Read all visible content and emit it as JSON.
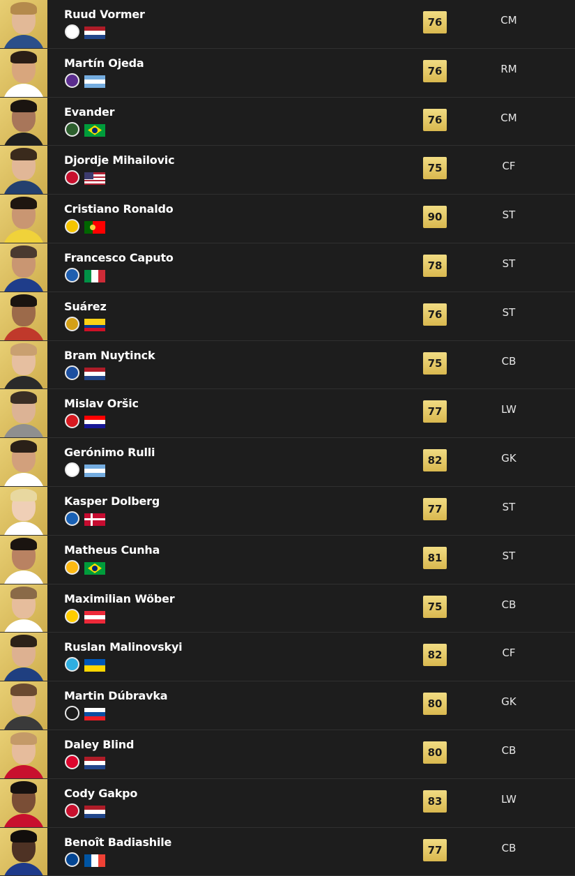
{
  "players": [
    {
      "name": "Ruud Vormer",
      "rating": "76",
      "position": "CM",
      "club_icon": "club-crest-icon",
      "nation": "netherlands-flag",
      "skin": "#e2b997",
      "hair": "#b48a4c",
      "kit": "#2b4f8a",
      "club_color": "#ffffff",
      "flag_colors": [
        "#ae1c28",
        "#ffffff",
        "#21468b"
      ],
      "flag_dir": "h"
    },
    {
      "name": "Martín Ojeda",
      "rating": "76",
      "position": "RM",
      "club_icon": "club-crest-icon",
      "nation": "argentina-flag",
      "skin": "#d8a67d",
      "hair": "#2a1e16",
      "kit": "#ffffff",
      "club_color": "#5b2d8e",
      "flag_colors": [
        "#74acdf",
        "#ffffff",
        "#74acdf"
      ],
      "flag_dir": "h"
    },
    {
      "name": "Evander",
      "rating": "76",
      "position": "CM",
      "club_icon": "club-crest-icon",
      "nation": "brazil-flag",
      "skin": "#a8765a",
      "hair": "#1a1410",
      "kit": "#1f1f1f",
      "club_color": "#2d5f2e",
      "flag_colors": [
        "#009c3b",
        "#ffdf00",
        "#002776"
      ],
      "flag_dir": "br"
    },
    {
      "name": "Djordje Mihailovic",
      "rating": "75",
      "position": "CF",
      "club_icon": "club-crest-icon",
      "nation": "usa-flag",
      "skin": "#e1b797",
      "hair": "#3a2a1c",
      "kit": "#24406e",
      "club_color": "#c8102e",
      "flag_colors": [
        "#b22234",
        "#ffffff",
        "#3c3b6e"
      ],
      "flag_dir": "us"
    },
    {
      "name": "Cristiano Ronaldo",
      "rating": "90",
      "position": "ST",
      "club_icon": "club-crest-icon",
      "nation": "portugal-flag",
      "skin": "#c99672",
      "hair": "#1e1610",
      "kit": "#f0d23a",
      "club_color": "#f5c400",
      "flag_colors": [
        "#006600",
        "#ff0000",
        "#ff0000"
      ],
      "flag_dir": "pt"
    },
    {
      "name": "Francesco Caputo",
      "rating": "78",
      "position": "ST",
      "club_icon": "club-crest-icon",
      "nation": "italy-flag",
      "skin": "#c99672",
      "hair": "#4a3a30",
      "kit": "#1f3d8a",
      "club_color": "#1f5fb0",
      "flag_colors": [
        "#009246",
        "#ffffff",
        "#ce2b37"
      ],
      "flag_dir": "v"
    },
    {
      "name": "Suárez",
      "rating": "76",
      "position": "ST",
      "club_icon": "club-crest-icon",
      "nation": "colombia-flag",
      "skin": "#9c6a4a",
      "hair": "#1a1410",
      "kit": "#c0392b",
      "club_color": "#d4a017",
      "flag_colors": [
        "#fcd116",
        "#003893",
        "#ce1126"
      ],
      "flag_dir": "co"
    },
    {
      "name": "Bram Nuytinck",
      "rating": "75",
      "position": "CB",
      "club_icon": "club-crest-icon",
      "nation": "netherlands-flag",
      "skin": "#e6bfa0",
      "hair": "#c9a070",
      "kit": "#2a2a2a",
      "club_color": "#1c4fa0",
      "flag_colors": [
        "#ae1c28",
        "#ffffff",
        "#21468b"
      ],
      "flag_dir": "h"
    },
    {
      "name": "Mislav Oršic",
      "rating": "77",
      "position": "LW",
      "club_icon": "club-crest-icon",
      "nation": "croatia-flag",
      "skin": "#dcb395",
      "hair": "#3a2e24",
      "kit": "#8f8f8f",
      "club_color": "#d71920",
      "flag_colors": [
        "#ff0000",
        "#ffffff",
        "#171796"
      ],
      "flag_dir": "h"
    },
    {
      "name": "Gerónimo Rulli",
      "rating": "82",
      "position": "GK",
      "club_icon": "club-crest-icon",
      "nation": "argentina-flag",
      "skin": "#d2a07c",
      "hair": "#2a2018",
      "kit": "#ffffff",
      "club_color": "#ffffff",
      "flag_colors": [
        "#74acdf",
        "#ffffff",
        "#74acdf"
      ],
      "flag_dir": "h"
    },
    {
      "name": "Kasper Dolberg",
      "rating": "77",
      "position": "ST",
      "club_icon": "club-crest-icon",
      "nation": "denmark-flag",
      "skin": "#efcfb6",
      "hair": "#e8d8a0",
      "kit": "#ffffff",
      "club_color": "#1961b5",
      "flag_colors": [
        "#c60c30",
        "#ffffff"
      ],
      "flag_dir": "dk"
    },
    {
      "name": "Matheus Cunha",
      "rating": "81",
      "position": "ST",
      "club_icon": "club-crest-icon",
      "nation": "brazil-flag",
      "skin": "#b98262",
      "hair": "#1a1410",
      "kit": "#ffffff",
      "club_color": "#fdb913",
      "flag_colors": [
        "#009c3b",
        "#ffdf00",
        "#002776"
      ],
      "flag_dir": "br"
    },
    {
      "name": "Maximilian Wöber",
      "rating": "75",
      "position": "CB",
      "club_icon": "club-crest-icon",
      "nation": "austria-flag",
      "skin": "#e6bd9c",
      "hair": "#8a6a48",
      "kit": "#ffffff",
      "club_color": "#ffcd00",
      "flag_colors": [
        "#ed2939",
        "#ffffff",
        "#ed2939"
      ],
      "flag_dir": "h"
    },
    {
      "name": "Ruslan Malinovskyi",
      "rating": "82",
      "position": "CF",
      "club_icon": "club-crest-icon",
      "nation": "ukraine-flag",
      "skin": "#ddb191",
      "hair": "#2c2218",
      "kit": "#1f3f80",
      "club_color": "#2faee0",
      "flag_colors": [
        "#0057b7",
        "#ffd700"
      ],
      "flag_dir": "h2"
    },
    {
      "name": "Martin Dúbravka",
      "rating": "80",
      "position": "GK",
      "club_icon": "club-crest-icon",
      "nation": "slovakia-flag",
      "skin": "#e2b796",
      "hair": "#6a4a30",
      "kit": "#3a3a3a",
      "club_color": "#1a1a1a",
      "flag_colors": [
        "#ffffff",
        "#0b4ea2",
        "#ee1c25"
      ],
      "flag_dir": "h"
    },
    {
      "name": "Daley Blind",
      "rating": "80",
      "position": "CB",
      "club_icon": "club-crest-icon",
      "nation": "netherlands-flag",
      "skin": "#e6bc9c",
      "hair": "#c49a68",
      "kit": "#c8102e",
      "club_color": "#dc052d",
      "flag_colors": [
        "#ae1c28",
        "#ffffff",
        "#21468b"
      ],
      "flag_dir": "h"
    },
    {
      "name": "Cody Gakpo",
      "rating": "83",
      "position": "LW",
      "club_icon": "club-crest-icon",
      "nation": "netherlands-flag",
      "skin": "#7a4e36",
      "hair": "#161210",
      "kit": "#c8102e",
      "club_color": "#c8102e",
      "flag_colors": [
        "#ae1c28",
        "#ffffff",
        "#21468b"
      ],
      "flag_dir": "h"
    },
    {
      "name": "Benoît Badiashile",
      "rating": "77",
      "position": "CB",
      "club_icon": "club-crest-icon",
      "nation": "france-flag",
      "skin": "#4e3224",
      "hair": "#120e0c",
      "kit": "#1e3a8a",
      "club_color": "#034694",
      "flag_colors": [
        "#0055a4",
        "#ffffff",
        "#ef4135"
      ],
      "flag_dir": "v"
    }
  ]
}
